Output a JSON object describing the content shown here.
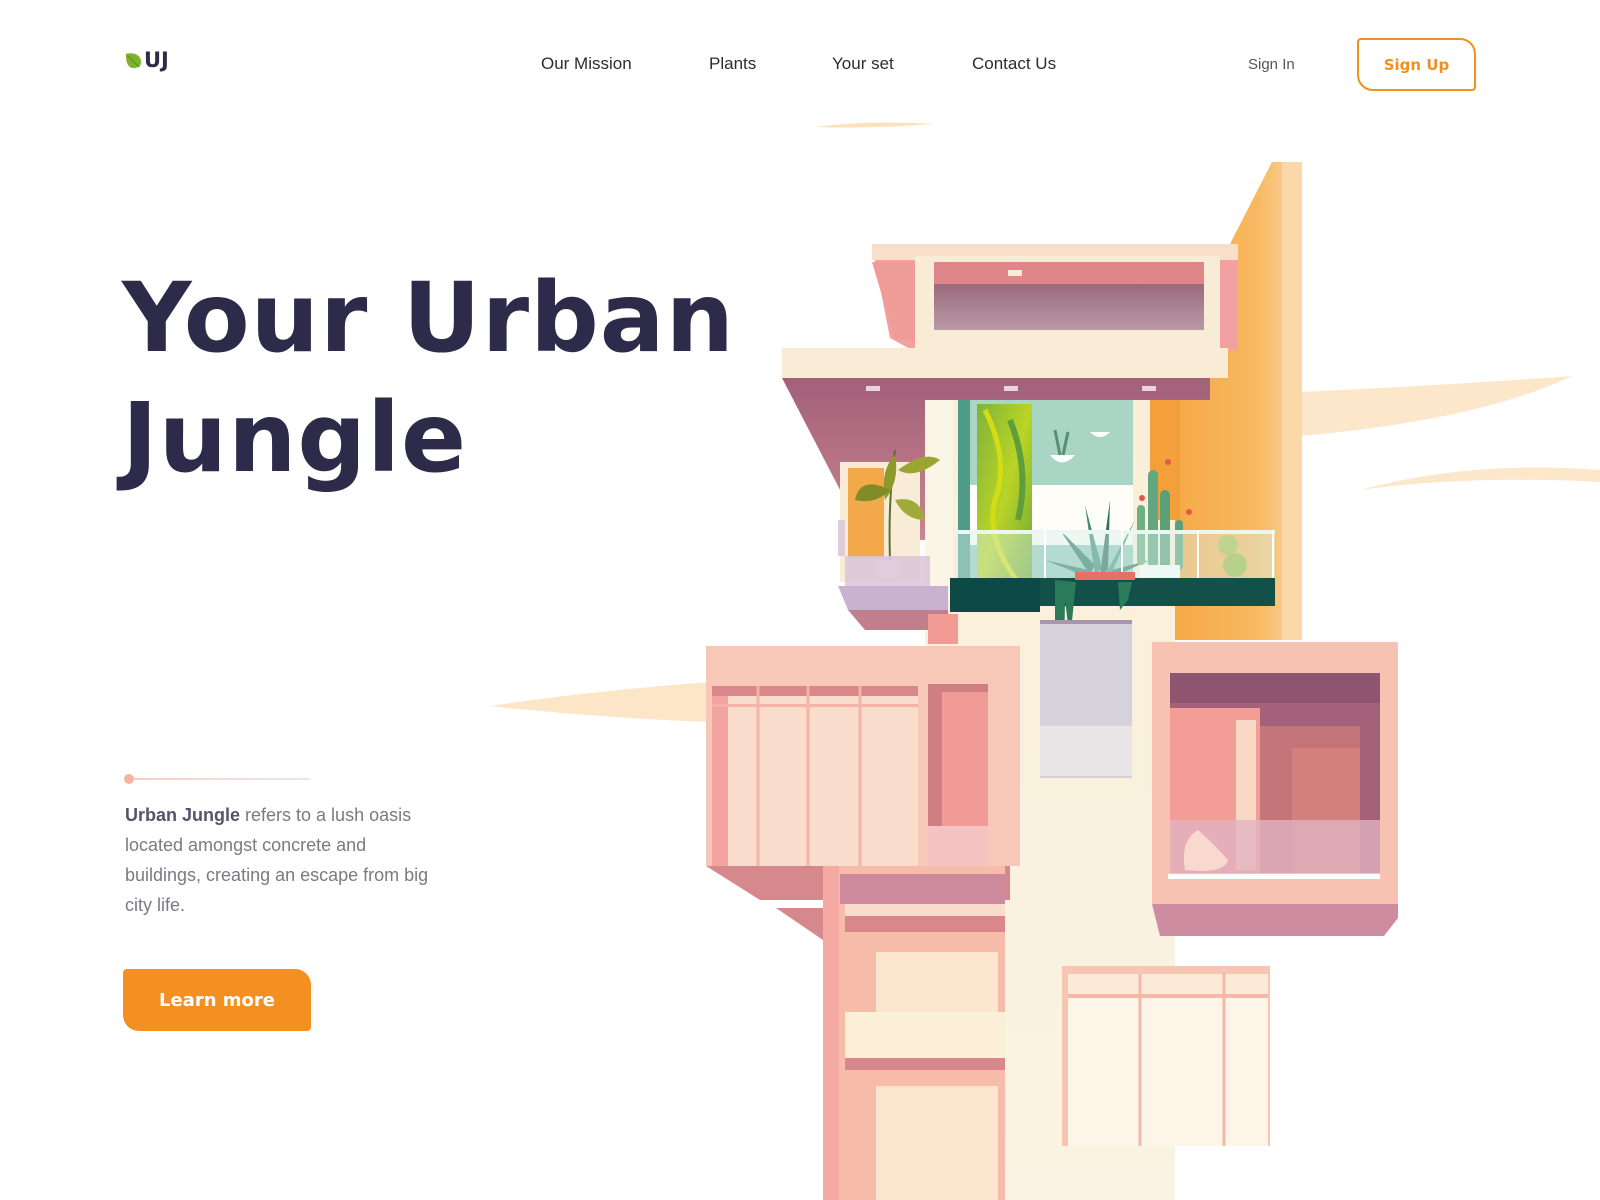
{
  "brand": {
    "logo_text": "UJ",
    "logo_icon": "leaf-icon",
    "leaf_color": "#7cb32b",
    "accent_color": "#f39021",
    "title_color": "#2d2a4a"
  },
  "nav": {
    "items": [
      {
        "label": "Our Mission"
      },
      {
        "label": "Plants"
      },
      {
        "label": "Your set"
      },
      {
        "label": "Contact Us"
      }
    ]
  },
  "auth": {
    "sign_in_label": "Sign In",
    "sign_up_label": "Sign Up"
  },
  "hero": {
    "title_line1": "Your Urban",
    "title_line2": "Jungle",
    "description_bold": "Urban Jungle",
    "description_rest": " refers to a lush oasis located amongst concrete and buildings, creating an escape from big city life.",
    "cta_label": "Learn more"
  },
  "illustration": {
    "subject": "pink modern apartment building with plant-filled balconies",
    "icon": "building-illustration"
  }
}
